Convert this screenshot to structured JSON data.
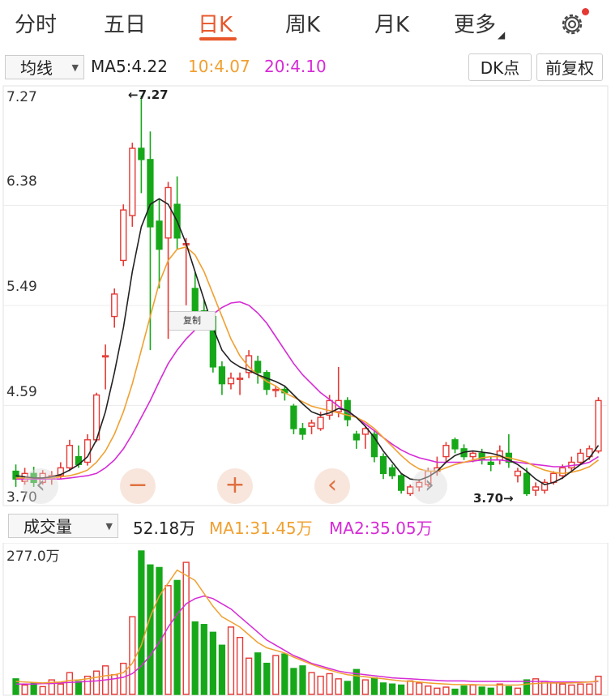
{
  "tabs": [
    {
      "label": "分时"
    },
    {
      "label": "五日"
    },
    {
      "label": "日K"
    },
    {
      "label": "周K"
    },
    {
      "label": "月K"
    },
    {
      "label": "更多"
    }
  ],
  "active_tab": "日K",
  "toolbar": {
    "indicator_select": "均线",
    "ma5": "MA5:4.22",
    "ma10": "10:4.07",
    "ma20": "20:4.10",
    "dk_button": "DK点",
    "adjust_button": "前复权"
  },
  "price_axis": {
    "labels": [
      "7.27",
      "6.38",
      "5.49",
      "4.59",
      "3.70"
    ]
  },
  "copy_tooltip": "复制",
  "nav_buttons": {
    "left": "‹",
    "minus": "−",
    "plus": "+",
    "back": "‹",
    "forward": "›"
  },
  "high_marker": "←7.27",
  "low_marker": "3.70→",
  "volume_bar": {
    "indicator_select": "成交量",
    "volume": "52.18万",
    "ma1": "MA1:31.45万",
    "ma2": "MA2:35.05万",
    "axis_max": "277.0万"
  },
  "colors": {
    "up": "#e53935",
    "down": "#17a81a",
    "ma_short": "#222222",
    "ma_mid": "#f0a030",
    "ma_long": "#d62bd6",
    "accent": "#e8572a"
  },
  "chart_data": {
    "type": "candlestick",
    "y_range": [
      3.7,
      7.27
    ],
    "candles": [
      {
        "o": 3.92,
        "c": 3.85,
        "h": 3.98,
        "l": 3.78
      },
      {
        "o": 3.83,
        "c": 3.9,
        "h": 3.95,
        "l": 3.8
      },
      {
        "o": 3.9,
        "c": 3.82,
        "h": 3.96,
        "l": 3.78
      },
      {
        "o": 3.82,
        "c": 3.9,
        "h": 3.93,
        "l": 3.8
      },
      {
        "o": 3.85,
        "c": 3.88,
        "h": 3.92,
        "l": 3.8
      },
      {
        "o": 3.88,
        "c": 3.95,
        "h": 4.0,
        "l": 3.85
      },
      {
        "o": 3.95,
        "c": 4.15,
        "h": 4.2,
        "l": 3.92
      },
      {
        "o": 4.05,
        "c": 3.98,
        "h": 4.15,
        "l": 3.95
      },
      {
        "o": 4.0,
        "c": 4.2,
        "h": 4.25,
        "l": 3.97
      },
      {
        "o": 4.2,
        "c": 4.6,
        "h": 4.62,
        "l": 4.18
      },
      {
        "o": 4.95,
        "c": 4.95,
        "h": 5.05,
        "l": 4.65
      },
      {
        "o": 5.3,
        "c": 5.5,
        "h": 5.55,
        "l": 5.2
      },
      {
        "o": 5.8,
        "c": 6.25,
        "h": 6.3,
        "l": 5.75
      },
      {
        "o": 6.2,
        "c": 6.8,
        "h": 6.85,
        "l": 6.1
      },
      {
        "o": 6.8,
        "c": 6.7,
        "h": 7.27,
        "l": 6.4
      },
      {
        "o": 6.7,
        "c": 6.1,
        "h": 6.95,
        "l": 5.0
      },
      {
        "o": 6.15,
        "c": 5.9,
        "h": 6.35,
        "l": 5.55
      },
      {
        "o": 6.0,
        "c": 6.45,
        "h": 6.5,
        "l": 5.1
      },
      {
        "o": 6.3,
        "c": 6.0,
        "h": 6.55,
        "l": 5.9
      },
      {
        "o": 5.95,
        "c": 5.95,
        "h": 6.0,
        "l": 5.4
      },
      {
        "o": 5.55,
        "c": 5.35,
        "h": 5.7,
        "l": 5.2
      },
      {
        "o": 5.35,
        "c": 5.3,
        "h": 5.45,
        "l": 5.2
      },
      {
        "o": 5.3,
        "c": 4.85,
        "h": 5.32,
        "l": 4.8
      },
      {
        "o": 4.85,
        "c": 4.7,
        "h": 4.9,
        "l": 4.6
      },
      {
        "o": 4.7,
        "c": 4.75,
        "h": 4.8,
        "l": 4.65
      },
      {
        "o": 4.75,
        "c": 4.75,
        "h": 4.8,
        "l": 4.6
      },
      {
        "o": 4.8,
        "c": 4.95,
        "h": 5.0,
        "l": 4.75
      },
      {
        "o": 4.9,
        "c": 4.8,
        "h": 4.95,
        "l": 4.7
      },
      {
        "o": 4.8,
        "c": 4.65,
        "h": 4.82,
        "l": 4.6
      },
      {
        "o": 4.65,
        "c": 4.65,
        "h": 4.68,
        "l": 4.58
      },
      {
        "o": 4.65,
        "c": 4.62,
        "h": 4.68,
        "l": 4.55
      },
      {
        "o": 4.5,
        "c": 4.3,
        "h": 4.52,
        "l": 4.25
      },
      {
        "o": 4.3,
        "c": 4.25,
        "h": 4.35,
        "l": 4.2
      },
      {
        "o": 4.32,
        "c": 4.35,
        "h": 4.38,
        "l": 4.25
      },
      {
        "o": 4.3,
        "c": 4.4,
        "h": 4.45,
        "l": 4.28
      },
      {
        "o": 4.42,
        "c": 4.55,
        "h": 4.6,
        "l": 4.38
      },
      {
        "o": 4.45,
        "c": 4.55,
        "h": 4.85,
        "l": 4.4
      },
      {
        "o": 4.55,
        "c": 4.38,
        "h": 4.58,
        "l": 4.32
      },
      {
        "o": 4.25,
        "c": 4.2,
        "h": 4.28,
        "l": 4.12
      },
      {
        "o": 4.25,
        "c": 4.3,
        "h": 4.32,
        "l": 4.12
      },
      {
        "o": 4.25,
        "c": 4.05,
        "h": 4.28,
        "l": 4.0
      },
      {
        "o": 4.05,
        "c": 3.9,
        "h": 4.08,
        "l": 3.85
      },
      {
        "o": 3.95,
        "c": 3.88,
        "h": 3.98,
        "l": 3.85
      },
      {
        "o": 3.88,
        "c": 3.75,
        "h": 3.9,
        "l": 3.72
      },
      {
        "o": 3.72,
        "c": 3.78,
        "h": 3.8,
        "l": 3.7
      },
      {
        "o": 3.78,
        "c": 3.82,
        "h": 3.85,
        "l": 3.74
      },
      {
        "o": 3.8,
        "c": 3.92,
        "h": 3.95,
        "l": 3.78
      },
      {
        "o": 3.92,
        "c": 3.95,
        "h": 4.05,
        "l": 3.88
      },
      {
        "o": 4.05,
        "c": 4.15,
        "h": 4.18,
        "l": 4.0
      },
      {
        "o": 4.2,
        "c": 4.12,
        "h": 4.22,
        "l": 4.08
      },
      {
        "o": 4.12,
        "c": 4.05,
        "h": 4.16,
        "l": 4.02
      },
      {
        "o": 4.05,
        "c": 4.08,
        "h": 4.1,
        "l": 4.0
      },
      {
        "o": 4.08,
        "c": 4.02,
        "h": 4.12,
        "l": 3.98
      },
      {
        "o": 4.0,
        "c": 3.98,
        "h": 4.05,
        "l": 3.92
      },
      {
        "o": 4.02,
        "c": 4.1,
        "h": 4.15,
        "l": 3.98
      },
      {
        "o": 4.08,
        "c": 4.0,
        "h": 4.25,
        "l": 3.95
      },
      {
        "o": 3.88,
        "c": 3.92,
        "h": 3.95,
        "l": 3.82
      },
      {
        "o": 3.9,
        "c": 3.72,
        "h": 3.95,
        "l": 3.7
      },
      {
        "o": 3.75,
        "c": 3.78,
        "h": 3.82,
        "l": 3.7
      },
      {
        "o": 3.75,
        "c": 3.82,
        "h": 3.85,
        "l": 3.72
      },
      {
        "o": 3.82,
        "c": 3.9,
        "h": 3.92,
        "l": 3.8
      },
      {
        "o": 3.88,
        "c": 3.95,
        "h": 3.98,
        "l": 3.85
      },
      {
        "o": 3.95,
        "c": 4.0,
        "h": 4.05,
        "l": 3.92
      },
      {
        "o": 4.0,
        "c": 4.08,
        "h": 4.12,
        "l": 3.98
      },
      {
        "o": 4.05,
        "c": 4.12,
        "h": 4.15,
        "l": 4.02
      },
      {
        "o": 4.1,
        "c": 4.55,
        "h": 4.58,
        "l": 4.08
      }
    ],
    "ma5": [
      3.88,
      3.87,
      3.86,
      3.86,
      3.87,
      3.89,
      3.93,
      3.98,
      4.05,
      4.2,
      4.45,
      4.8,
      5.2,
      5.7,
      6.1,
      6.3,
      6.35,
      6.3,
      6.15,
      5.95,
      5.7,
      5.45,
      5.2,
      5.0,
      4.9,
      4.85,
      4.82,
      4.78,
      4.75,
      4.72,
      4.68,
      4.6,
      4.52,
      4.45,
      4.42,
      4.44,
      4.48,
      4.46,
      4.4,
      4.32,
      4.22,
      4.1,
      4.0,
      3.9,
      3.85,
      3.84,
      3.87,
      3.92,
      4.0,
      4.06,
      4.09,
      4.1,
      4.09,
      4.08,
      4.06,
      4.02,
      3.98,
      3.92,
      3.85,
      3.8,
      3.82,
      3.86,
      3.92,
      3.98,
      4.04,
      4.15
    ],
    "ma10": [
      3.86,
      3.86,
      3.86,
      3.86,
      3.86,
      3.87,
      3.88,
      3.9,
      3.93,
      4.0,
      4.1,
      4.25,
      4.45,
      4.7,
      5.0,
      5.3,
      5.6,
      5.8,
      5.9,
      5.92,
      5.85,
      5.7,
      5.5,
      5.3,
      5.1,
      4.95,
      4.85,
      4.78,
      4.72,
      4.68,
      4.62,
      4.58,
      4.54,
      4.5,
      4.48,
      4.46,
      4.44,
      4.42,
      4.4,
      4.36,
      4.3,
      4.22,
      4.14,
      4.06,
      3.99,
      3.94,
      3.92,
      3.92,
      3.95,
      3.98,
      4.0,
      4.02,
      4.04,
      4.05,
      4.05,
      4.04,
      4.02,
      4.0,
      3.96,
      3.93,
      3.91,
      3.9,
      3.91,
      3.93,
      3.96,
      4.02
    ],
    "ma20": [
      3.85,
      3.85,
      3.85,
      3.85,
      3.85,
      3.85,
      3.86,
      3.87,
      3.88,
      3.9,
      3.95,
      4.02,
      4.12,
      4.25,
      4.4,
      4.55,
      4.72,
      4.88,
      5.0,
      5.1,
      5.18,
      5.25,
      5.32,
      5.38,
      5.42,
      5.43,
      5.4,
      5.33,
      5.24,
      5.12,
      5.0,
      4.88,
      4.78,
      4.7,
      4.62,
      4.56,
      4.5,
      4.45,
      4.4,
      4.34,
      4.28,
      4.22,
      4.16,
      4.11,
      4.07,
      4.04,
      4.02,
      4.0,
      4.0,
      4.0,
      4.0,
      4.01,
      4.02,
      4.02,
      4.02,
      4.01,
      4.0,
      3.99,
      3.98,
      3.97,
      3.96,
      3.96,
      3.97,
      3.98,
      4.0,
      4.05
    ],
    "volume": {
      "y_max": 277.0,
      "values": [
        30,
        18,
        22,
        15,
        28,
        20,
        42,
        25,
        35,
        45,
        55,
        38,
        60,
        150,
        277,
        250,
        245,
        210,
        220,
        255,
        140,
        135,
        120,
        95,
        130,
        110,
        70,
        80,
        60,
        75,
        78,
        50,
        55,
        42,
        35,
        40,
        30,
        25,
        48,
        28,
        32,
        22,
        20,
        18,
        26,
        22,
        16,
        12,
        14,
        10,
        16,
        18,
        14,
        12,
        20,
        15,
        12,
        28,
        30,
        25,
        22,
        20,
        18,
        20,
        20,
        35
      ],
      "ma1": [
        25,
        24,
        23,
        22,
        23,
        24,
        27,
        28,
        30,
        33,
        36,
        38,
        42,
        60,
        95,
        150,
        190,
        215,
        240,
        230,
        220,
        195,
        170,
        150,
        140,
        130,
        115,
        100,
        90,
        85,
        80,
        72,
        65,
        58,
        52,
        47,
        42,
        38,
        36,
        34,
        32,
        30,
        28,
        26,
        25,
        24,
        22,
        21,
        20,
        19,
        19,
        19,
        18,
        18,
        18,
        18,
        18,
        20,
        21,
        22,
        22,
        22,
        22,
        23,
        24,
        26
      ],
      "ma2": [
        20,
        20,
        20,
        21,
        21,
        22,
        23,
        24,
        25,
        26,
        28,
        30,
        33,
        40,
        55,
        75,
        100,
        130,
        155,
        175,
        185,
        190,
        185,
        175,
        165,
        150,
        135,
        120,
        105,
        95,
        85,
        75,
        68,
        60,
        55,
        50,
        45,
        42,
        40,
        38,
        36,
        34,
        32,
        31,
        30,
        29,
        28,
        27,
        26,
        26,
        26,
        25,
        25,
        25,
        25,
        25,
        25,
        25,
        25,
        25,
        24,
        24,
        24,
        24,
        24,
        25
      ]
    }
  }
}
